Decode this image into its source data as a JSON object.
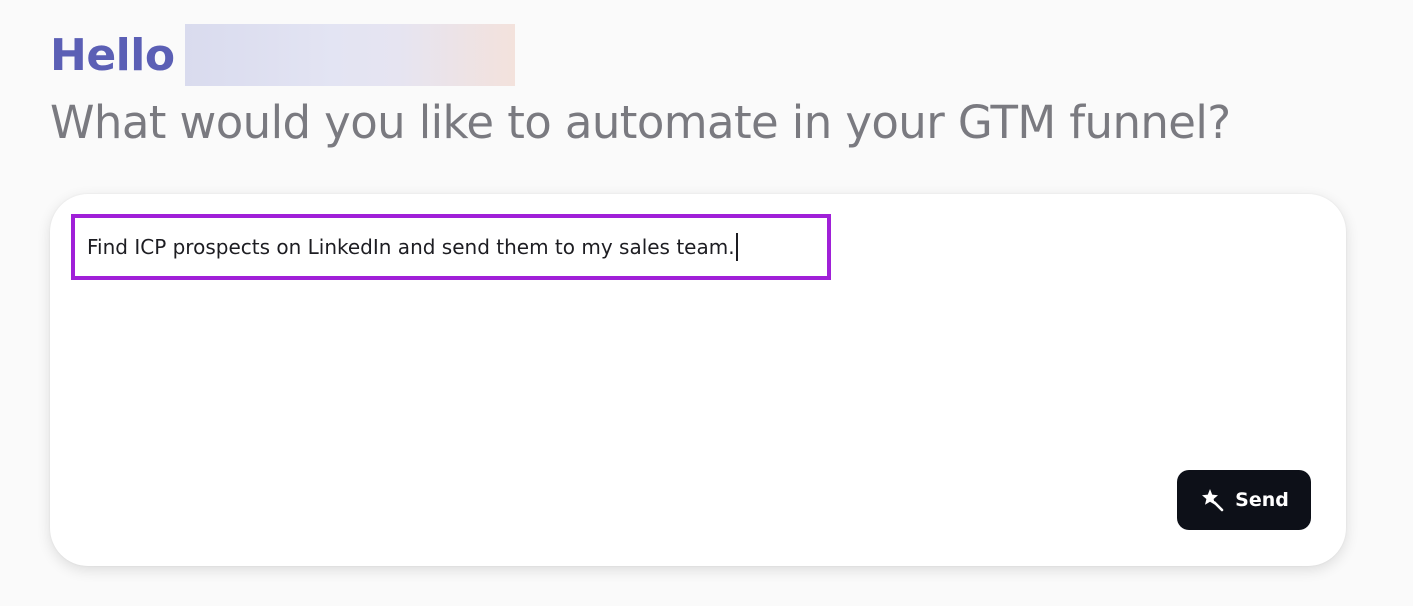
{
  "header": {
    "greeting": "Hello",
    "subtitle": "What would you like to automate in your GTM funnel?"
  },
  "composer": {
    "input_value": "Find ICP prospects on LinkedIn and send them to my sales team.",
    "send_label": "Send",
    "send_icon": "magic-wand-icon"
  },
  "colors": {
    "greeting": "#5b5fb5",
    "subtitle": "#7a7a80",
    "highlight_border": "#a020d8",
    "send_button": "#0d1018"
  }
}
